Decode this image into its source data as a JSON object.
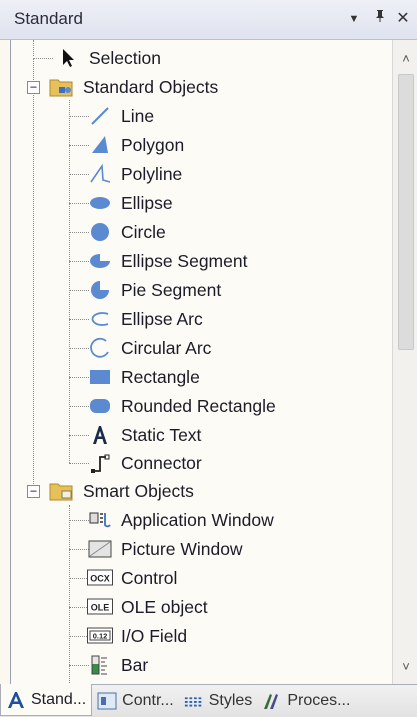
{
  "window": {
    "title": "Standard",
    "dropdown_glyph": "▼",
    "pin_glyph": "չ",
    "close_glyph": "✕"
  },
  "tree": {
    "selection": {
      "label": "Selection",
      "icon": "arrow-pointer-icon"
    },
    "standard_objects": {
      "label": "Standard Objects",
      "expander": "−",
      "icon": "folder-shapes-icon",
      "items": [
        {
          "label": "Line",
          "icon": "line-icon"
        },
        {
          "label": "Polygon",
          "icon": "polygon-icon"
        },
        {
          "label": "Polyline",
          "icon": "polyline-icon"
        },
        {
          "label": "Ellipse",
          "icon": "ellipse-icon"
        },
        {
          "label": "Circle",
          "icon": "circle-icon"
        },
        {
          "label": "Ellipse Segment",
          "icon": "ellipse-segment-icon"
        },
        {
          "label": "Pie Segment",
          "icon": "pie-segment-icon"
        },
        {
          "label": "Ellipse Arc",
          "icon": "ellipse-arc-icon"
        },
        {
          "label": "Circular Arc",
          "icon": "circular-arc-icon"
        },
        {
          "label": "Rectangle",
          "icon": "rectangle-icon"
        },
        {
          "label": "Rounded Rectangle",
          "icon": "rounded-rectangle-icon"
        },
        {
          "label": "Static Text",
          "icon": "static-text-icon"
        },
        {
          "label": "Connector",
          "icon": "connector-icon"
        }
      ]
    },
    "smart_objects": {
      "label": "Smart Objects",
      "expander": "−",
      "icon": "folder-smart-icon",
      "items": [
        {
          "label": "Application Window",
          "icon": "application-window-icon"
        },
        {
          "label": "Picture Window",
          "icon": "picture-window-icon"
        },
        {
          "label": "Control",
          "icon": "control-icon",
          "icon_text": "OCX"
        },
        {
          "label": "OLE object",
          "icon": "ole-object-icon",
          "icon_text": "OLE"
        },
        {
          "label": "I/O Field",
          "icon": "io-field-icon",
          "icon_text": "0.12"
        },
        {
          "label": "Bar",
          "icon": "bar-icon"
        }
      ]
    }
  },
  "scrollbar": {
    "up_glyph": "˄",
    "down_glyph": "˅"
  },
  "tabs": [
    {
      "label": "Stand...",
      "icon": "standard-tab-icon",
      "active": true
    },
    {
      "label": "Contr...",
      "icon": "controls-tab-icon",
      "active": false
    },
    {
      "label": "Styles",
      "icon": "styles-tab-icon",
      "active": false
    },
    {
      "label": "Proces...",
      "icon": "process-tab-icon",
      "active": false
    }
  ],
  "colors": {
    "accent_blue": "#3f6fbf",
    "icon_fill": "#6f95cf",
    "title_bg": "#e7eaf2"
  }
}
